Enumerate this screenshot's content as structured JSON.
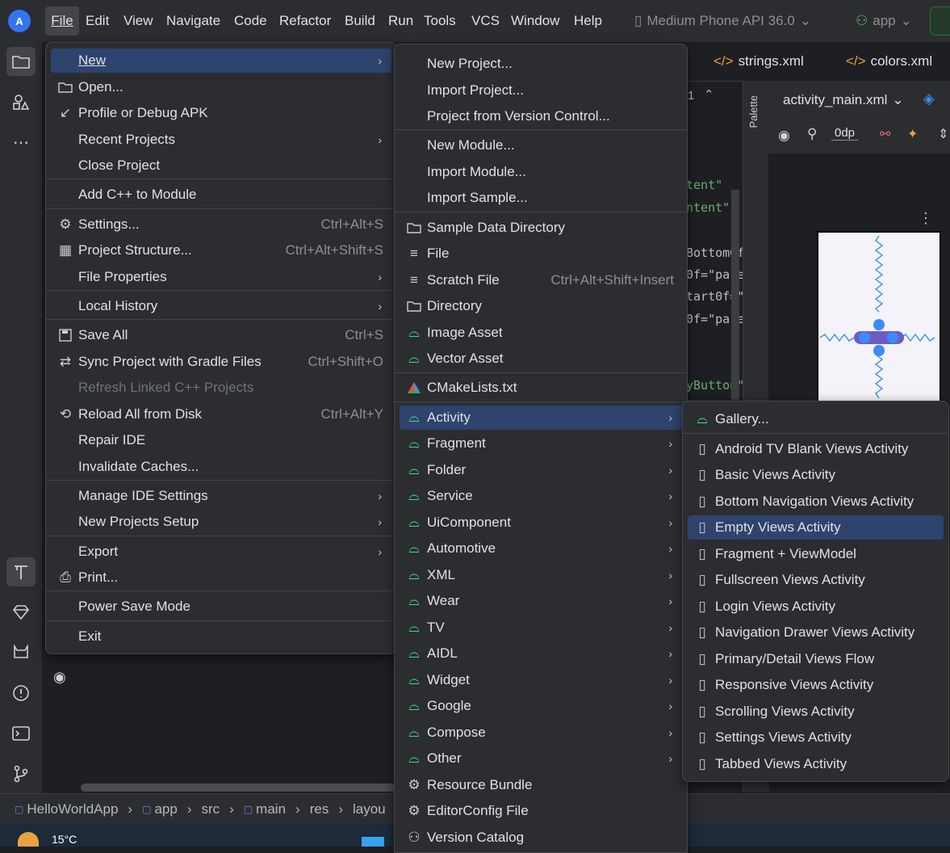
{
  "menubar": {
    "items": [
      "File",
      "Edit",
      "View",
      "Navigate",
      "Code",
      "Refactor",
      "Build",
      "Run",
      "Tools",
      "VCS",
      "Window",
      "Help"
    ],
    "device": "Medium Phone API 36.0",
    "app": "app"
  },
  "editor": {
    "tabs": [
      "strings.xml",
      "colors.xml"
    ],
    "design_file": "activity_main.xml",
    "margin": "0dp",
    "palette_label": "Palette",
    "line_no": "1",
    "code_lines": [
      "tent\"",
      "ntent\"",
      "Bottom0f",
      "0f=\"pare",
      "tart0f=\"",
      "0f=\"pare",
      "yButton\""
    ]
  },
  "file_menu": {
    "items": [
      {
        "label": "New",
        "accel": "N",
        "arrow": true
      },
      {
        "label": "Open...",
        "accel": "O"
      },
      {
        "label": "Profile or Debug APK"
      },
      {
        "label": "Recent Projects",
        "accel": "R",
        "arrow": true
      },
      {
        "label": "Close Project"
      },
      {
        "label": "Add C++ to Module"
      },
      {
        "label": "Settings...",
        "shortcut": "Ctrl+Alt+S"
      },
      {
        "label": "Project Structure...",
        "shortcut": "Ctrl+Alt+Shift+S"
      },
      {
        "label": "File Properties",
        "arrow": true
      },
      {
        "label": "Local History",
        "arrow": true
      },
      {
        "label": "Save All",
        "shortcut": "Ctrl+S"
      },
      {
        "label": "Sync Project with Gradle Files",
        "shortcut": "Ctrl+Shift+O"
      },
      {
        "label": "Refresh Linked C++ Projects",
        "disabled": true
      },
      {
        "label": "Reload All from Disk",
        "shortcut": "Ctrl+Alt+Y"
      },
      {
        "label": "Repair IDE"
      },
      {
        "label": "Invalidate Caches..."
      },
      {
        "label": "Manage IDE Settings",
        "arrow": true
      },
      {
        "label": "New Projects Setup",
        "arrow": true
      },
      {
        "label": "Export",
        "arrow": true
      },
      {
        "label": "Print..."
      },
      {
        "label": "Power Save Mode"
      },
      {
        "label": "Exit"
      }
    ]
  },
  "new_menu": {
    "items": [
      {
        "label": "New Project..."
      },
      {
        "label": "Import Project..."
      },
      {
        "label": "Project from Version Control..."
      },
      {
        "label": "New Module..."
      },
      {
        "label": "Import Module..."
      },
      {
        "label": "Import Sample..."
      },
      {
        "label": "Sample Data Directory"
      },
      {
        "label": "File"
      },
      {
        "label": "Scratch File",
        "shortcut": "Ctrl+Alt+Shift+Insert"
      },
      {
        "label": "Directory"
      },
      {
        "label": "Image Asset"
      },
      {
        "label": "Vector Asset"
      },
      {
        "label": "CMakeLists.txt"
      },
      {
        "label": "Activity",
        "arrow": true
      },
      {
        "label": "Fragment",
        "arrow": true
      },
      {
        "label": "Folder",
        "arrow": true
      },
      {
        "label": "Service",
        "arrow": true
      },
      {
        "label": "UiComponent",
        "arrow": true
      },
      {
        "label": "Automotive",
        "arrow": true
      },
      {
        "label": "XML",
        "arrow": true
      },
      {
        "label": "Wear",
        "arrow": true
      },
      {
        "label": "TV",
        "arrow": true
      },
      {
        "label": "AIDL",
        "arrow": true
      },
      {
        "label": "Widget",
        "arrow": true
      },
      {
        "label": "Google",
        "arrow": true
      },
      {
        "label": "Compose",
        "arrow": true
      },
      {
        "label": "Other",
        "arrow": true
      },
      {
        "label": "Resource Bundle"
      },
      {
        "label": "EditorConfig File"
      },
      {
        "label": "Version Catalog"
      }
    ]
  },
  "activity_menu": {
    "items": [
      {
        "label": "Gallery..."
      },
      {
        "label": "Android TV Blank Views Activity"
      },
      {
        "label": "Basic Views Activity"
      },
      {
        "label": "Bottom Navigation Views Activity"
      },
      {
        "label": "Empty Views Activity"
      },
      {
        "label": "Fragment + ViewModel"
      },
      {
        "label": "Fullscreen Views Activity"
      },
      {
        "label": "Login Views Activity"
      },
      {
        "label": "Navigation Drawer Views Activity"
      },
      {
        "label": "Primary/Detail Views Flow"
      },
      {
        "label": "Responsive Views Activity"
      },
      {
        "label": "Scrolling Views Activity"
      },
      {
        "label": "Settings Views Activity"
      },
      {
        "label": "Tabbed Views Activity"
      }
    ]
  },
  "breadcrumb": [
    "HelloWorldApp",
    "app",
    "src",
    "main",
    "res",
    "layou"
  ],
  "taskbar": {
    "weather": "15°C"
  },
  "colors": {
    "accent": "#2e436e",
    "android_green": "#3ddc84",
    "bg": "#2b2d30"
  }
}
